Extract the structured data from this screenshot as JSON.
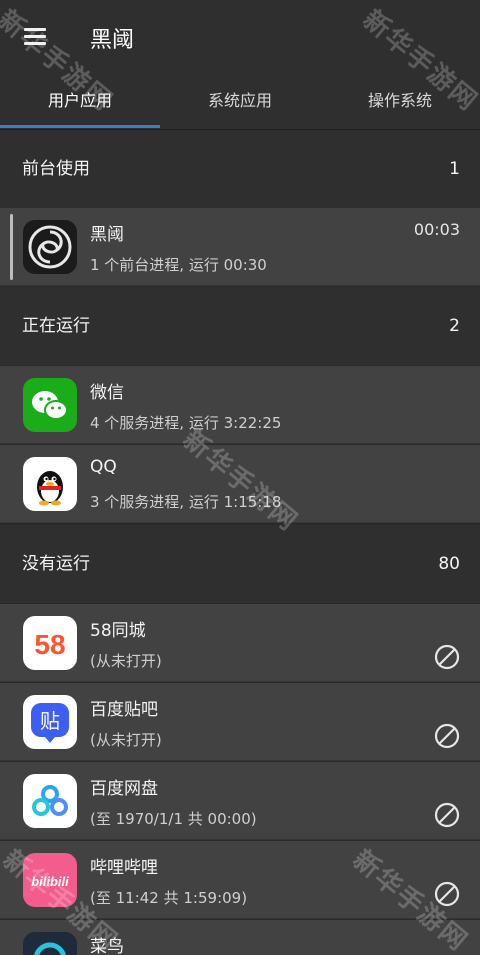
{
  "app": {
    "title": "黑阈"
  },
  "tabs": [
    {
      "label": "用户应用",
      "active": true
    },
    {
      "label": "系统应用",
      "active": false
    },
    {
      "label": "操作系统",
      "active": false
    }
  ],
  "sections": {
    "foreground": {
      "label": "前台使用",
      "count": "1"
    },
    "running": {
      "label": "正在运行",
      "count": "2"
    },
    "stopped": {
      "label": "没有运行",
      "count": "80"
    }
  },
  "foreground_apps": [
    {
      "name": "黑阈",
      "status": "1 个前台进程, 运行 00:30",
      "time": "00:03",
      "icon": "heiyu-swirl-icon"
    }
  ],
  "running_apps": [
    {
      "name": "微信",
      "status": "4 个服务进程, 运行 3:22:25",
      "icon": "wechat-icon"
    },
    {
      "name": "QQ",
      "status": "3 个服务进程, 运行 1:15:18",
      "icon": "qq-penguin-icon"
    }
  ],
  "stopped_apps": [
    {
      "name": "58同城",
      "status": "(从未打开)",
      "icon": "58-tongcheng-icon",
      "icon_text": "58"
    },
    {
      "name": "百度贴吧",
      "status": "(从未打开)",
      "icon": "tieba-icon",
      "icon_text": "贴"
    },
    {
      "name": "百度网盘",
      "status": "(至 1970/1/1 共 00:00)",
      "icon": "baidu-netdisk-icon"
    },
    {
      "name": "哔哩哔哩",
      "status": "(至 11:42 共 1:59:09)",
      "icon": "bilibili-icon",
      "icon_text": "bilibili"
    },
    {
      "name": "菜鸟",
      "status": "",
      "icon": "cainiao-icon"
    }
  ],
  "watermark": "新华手游网",
  "colors": {
    "accent": "#3d7ec9",
    "wechat": "#1aad19",
    "tieba": "#3d5ef2",
    "bilibili": "#f25d8e"
  }
}
